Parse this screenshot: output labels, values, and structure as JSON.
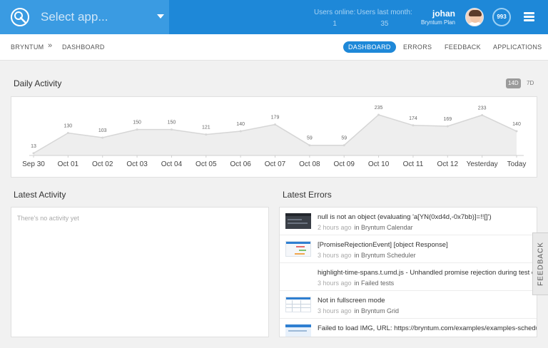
{
  "header": {
    "app_select": {
      "label": "Select app...",
      "logo_icon": "bryntum-logo-icon"
    },
    "stats": [
      {
        "label": "Users online:",
        "value": "1"
      },
      {
        "label": "Users last month:",
        "value": "35"
      }
    ],
    "user": {
      "name": "johan",
      "plan": "Bryntum Plan"
    },
    "badge": "993",
    "menu_icon": "hamburger-icon",
    "colors": {
      "bar": "#1e88d8",
      "select": "#3a9be2"
    }
  },
  "nav": {
    "breadcrumb": [
      "BRYNTUM",
      "DASHBOARD"
    ],
    "breadcrumb_separator": "»",
    "tabs": [
      {
        "label": "DASHBOARD",
        "active": true
      },
      {
        "label": "ERRORS",
        "active": false
      },
      {
        "label": "FEEDBACK",
        "active": false
      },
      {
        "label": "APPLICATIONS",
        "active": false
      }
    ]
  },
  "daily_activity": {
    "title": "Daily Activity",
    "ranges": [
      {
        "label": "14D",
        "active": true
      },
      {
        "label": "7D",
        "active": false
      }
    ]
  },
  "chart_data": {
    "type": "area",
    "title": "Daily Activity",
    "categories": [
      "Sep 30",
      "Oct 01",
      "Oct 02",
      "Oct 03",
      "Oct 04",
      "Oct 05",
      "Oct 06",
      "Oct 07",
      "Oct 08",
      "Oct 09",
      "Oct 10",
      "Oct 11",
      "Oct 12",
      "Yesterday",
      "Today"
    ],
    "values": [
      13,
      130,
      103,
      150,
      150,
      121,
      140,
      179,
      59,
      59,
      235,
      174,
      169,
      233,
      140
    ],
    "ylim": [
      0,
      235
    ],
    "grid": false,
    "data_labels": true,
    "colors": {
      "fill": "#eeeeee",
      "line": "#d6d6d6",
      "label": "#666666"
    }
  },
  "latest_activity": {
    "title": "Latest Activity",
    "empty_text": "There's no activity yet"
  },
  "latest_errors": {
    "title": "Latest Errors",
    "items": [
      {
        "title": "null is not an object (evaluating 'a[YN(0xd4d,-0x7bb)]=!![]')",
        "ago": "2 hours ago",
        "where": "in Bryntum Calendar",
        "thumb": "dark"
      },
      {
        "title": "[PromiseRejectionEvent] [object Response]",
        "ago": "3 hours ago",
        "where": "in Bryntum Scheduler",
        "thumb": "gantt"
      },
      {
        "title": "highlight-time-spans.t.umd.js - Unhandled promise rejection during test execution",
        "ago": "3 hours ago",
        "where": "in Failed tests",
        "thumb": "none"
      },
      {
        "title": "Not in fullscreen mode",
        "ago": "3 hours ago",
        "where": "in Bryntum Grid",
        "thumb": "grid"
      },
      {
        "title": "Failed to load IMG, URL: https://bryntum.com/examples/examples-scheduler",
        "ago": "",
        "where": "",
        "thumb": "blue"
      }
    ]
  },
  "feedback_tab": {
    "label": "FEEDBACK"
  }
}
